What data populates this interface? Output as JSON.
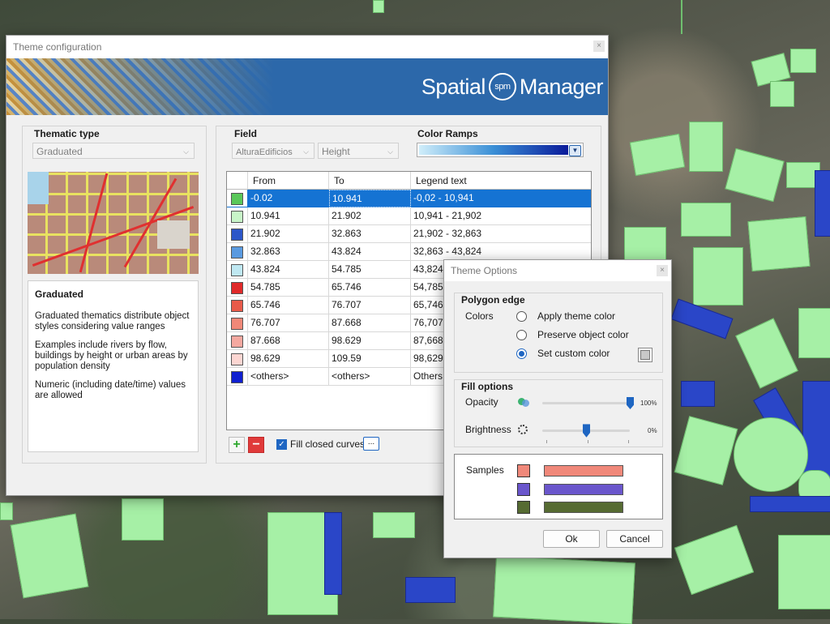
{
  "main_dialog": {
    "title": "Theme configuration",
    "close_glyph": "×",
    "brand": {
      "left": "Spatial",
      "logo": "spm",
      "right": "Manager"
    },
    "thematic_type": {
      "title": "Thematic type",
      "selected": "Graduated",
      "description_title": "Graduated",
      "description_paragraphs": [
        "Graduated thematics distribute object styles considering value ranges",
        "Examples include rivers by flow, buildings by height or urban areas by population density",
        "Numeric (including date/time) values are allowed"
      ]
    },
    "field": {
      "title": "Field",
      "table": "AlturaEdificios",
      "column": "Height"
    },
    "color_ramps": {
      "title": "Color Ramps"
    },
    "grid": {
      "headers": [
        "From",
        "To",
        "Legend text"
      ],
      "rows": [
        {
          "color": "#5ac85a",
          "from": "-0.02",
          "to": "10.941",
          "legend": "-0,02 - 10,941"
        },
        {
          "color": "#c8f5c8",
          "from": "10.941",
          "to": "21.902",
          "legend": "10,941 - 21,902"
        },
        {
          "color": "#2c56c8",
          "from": "21.902",
          "to": "32.863",
          "legend": "21,902 - 32,863"
        },
        {
          "color": "#5a9ae0",
          "from": "32.863",
          "to": "43.824",
          "legend": "32,863 - 43,824"
        },
        {
          "color": "#bfe8f2",
          "from": "43.824",
          "to": "54.785",
          "legend": "43,824 - 54,785"
        },
        {
          "color": "#e02a2a",
          "from": "54.785",
          "to": "65.746",
          "legend": "54,785 - 65,746"
        },
        {
          "color": "#e85a4a",
          "from": "65.746",
          "to": "76.707",
          "legend": "65,746 - 76,707"
        },
        {
          "color": "#f08878",
          "from": "76.707",
          "to": "87.668",
          "legend": "76,707 - 87,668"
        },
        {
          "color": "#f4a8a0",
          "from": "87.668",
          "to": "98.629",
          "legend": "87,668 - 98,629"
        },
        {
          "color": "#fcd6d2",
          "from": "98.629",
          "to": "109.59",
          "legend": "98,629 - 109,59"
        },
        {
          "color": "#1020d0",
          "from": "<others>",
          "to": "<others>",
          "legend": "Others"
        }
      ]
    },
    "add_label": "+",
    "remove_label": "−",
    "fill_closed_curves": {
      "label": "Fill closed curves",
      "checked": true,
      "check_glyph": "✓",
      "more": "..."
    }
  },
  "options_dialog": {
    "title": "Theme Options",
    "close_glyph": "×",
    "polygon_edge": {
      "title": "Polygon edge",
      "colors_label": "Colors",
      "options": [
        "Apply theme color",
        "Preserve object color",
        "Set custom color"
      ],
      "selected_index": 2
    },
    "fill_options": {
      "title": "Fill options",
      "opacity": {
        "label": "Opacity",
        "value": 100,
        "value_text": "100%"
      },
      "brightness": {
        "label": "Brightness",
        "value": 0,
        "value_text": "0%"
      }
    },
    "samples": {
      "label": "Samples",
      "items": [
        {
          "color": "#f0887a"
        },
        {
          "color": "#6a56cc"
        },
        {
          "color": "#566b32"
        }
      ]
    },
    "ok_label": "Ok",
    "cancel_label": "Cancel"
  }
}
